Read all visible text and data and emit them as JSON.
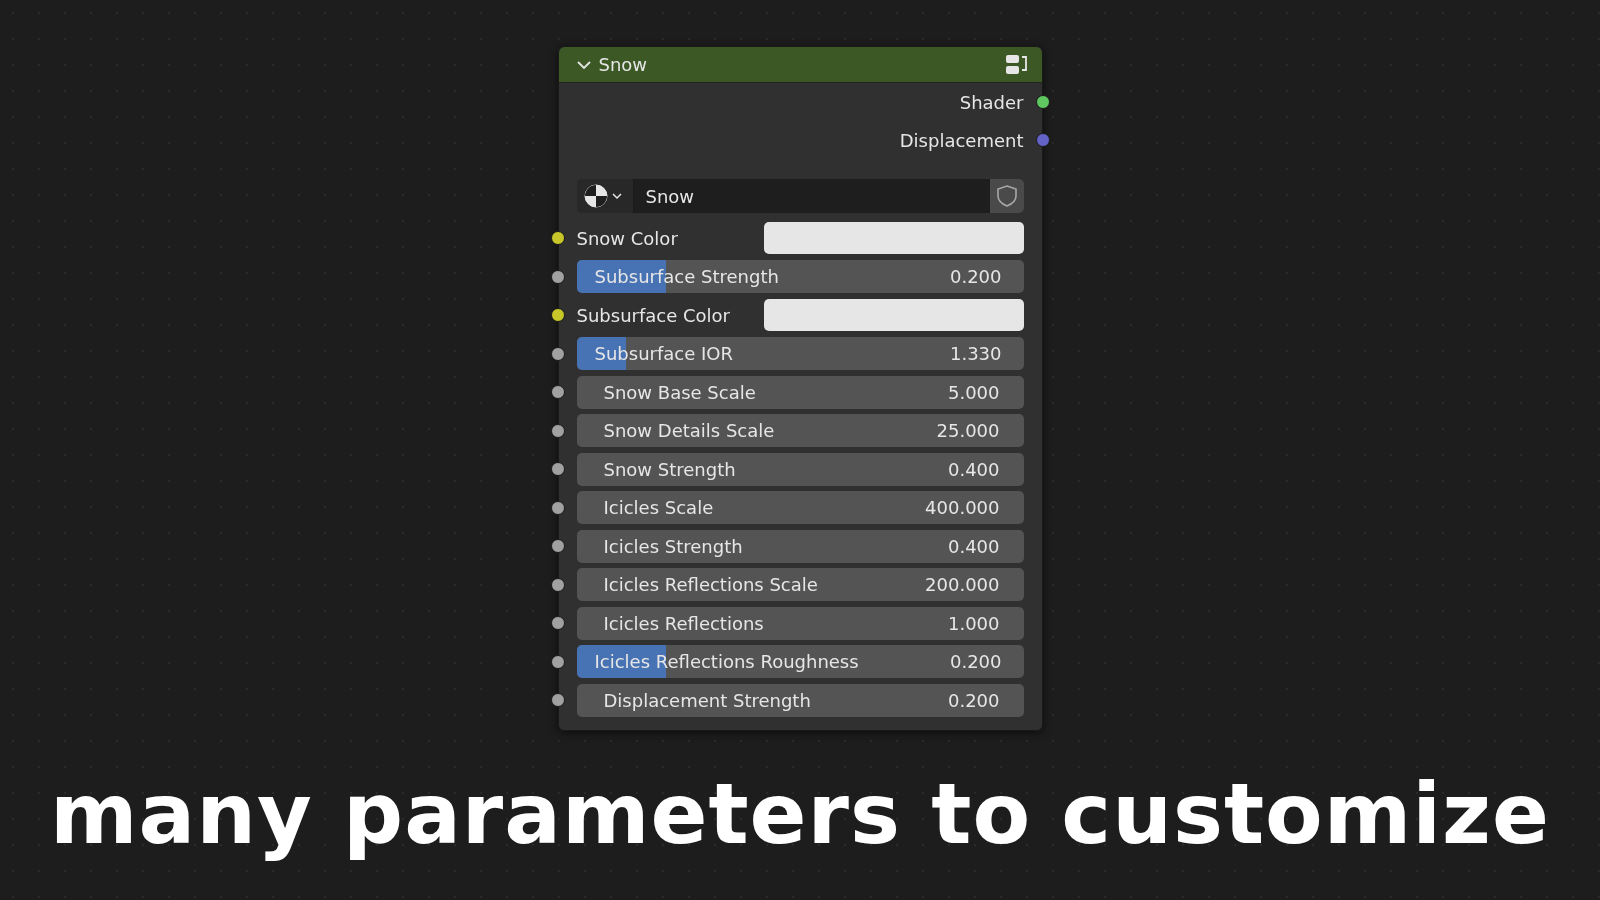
{
  "node": {
    "title": "Snow",
    "expanded": true,
    "outputs": [
      {
        "label": "Shader",
        "color": "#5fc75f"
      },
      {
        "label": "Displacement",
        "color": "#6363c7"
      }
    ],
    "material": {
      "name": "Snow"
    },
    "inputs": [
      {
        "kind": "color",
        "label": "Snow Color",
        "color": "#c7c729"
      },
      {
        "kind": "slider",
        "label": "Subsurface Strength",
        "value": "0.200",
        "level": 0.2,
        "color": "#a1a1a1"
      },
      {
        "kind": "color",
        "label": "Subsurface Color",
        "color": "#c7c729"
      },
      {
        "kind": "slider",
        "label": "Subsurface IOR",
        "value": "1.330",
        "level": 0.11,
        "color": "#a1a1a1"
      },
      {
        "kind": "number",
        "label": "Snow Base Scale",
        "value": "5.000",
        "color": "#a1a1a1"
      },
      {
        "kind": "number",
        "label": "Snow Details Scale",
        "value": "25.000",
        "color": "#a1a1a1"
      },
      {
        "kind": "number",
        "label": "Snow Strength",
        "value": "0.400",
        "color": "#a1a1a1"
      },
      {
        "kind": "number",
        "label": "Icicles Scale",
        "value": "400.000",
        "color": "#a1a1a1"
      },
      {
        "kind": "number",
        "label": "Icicles Strength",
        "value": "0.400",
        "color": "#a1a1a1"
      },
      {
        "kind": "number",
        "label": "Icicles Reflections Scale",
        "value": "200.000",
        "color": "#a1a1a1"
      },
      {
        "kind": "number",
        "label": "Icicles Reflections",
        "value": "1.000",
        "color": "#a1a1a1"
      },
      {
        "kind": "slider",
        "label": "Icicles Reflections Roughness",
        "value": "0.200",
        "level": 0.2,
        "color": "#a1a1a1"
      },
      {
        "kind": "number",
        "label": "Displacement Strength",
        "value": "0.200",
        "color": "#a1a1a1"
      }
    ]
  },
  "caption": "many parameters to customize"
}
